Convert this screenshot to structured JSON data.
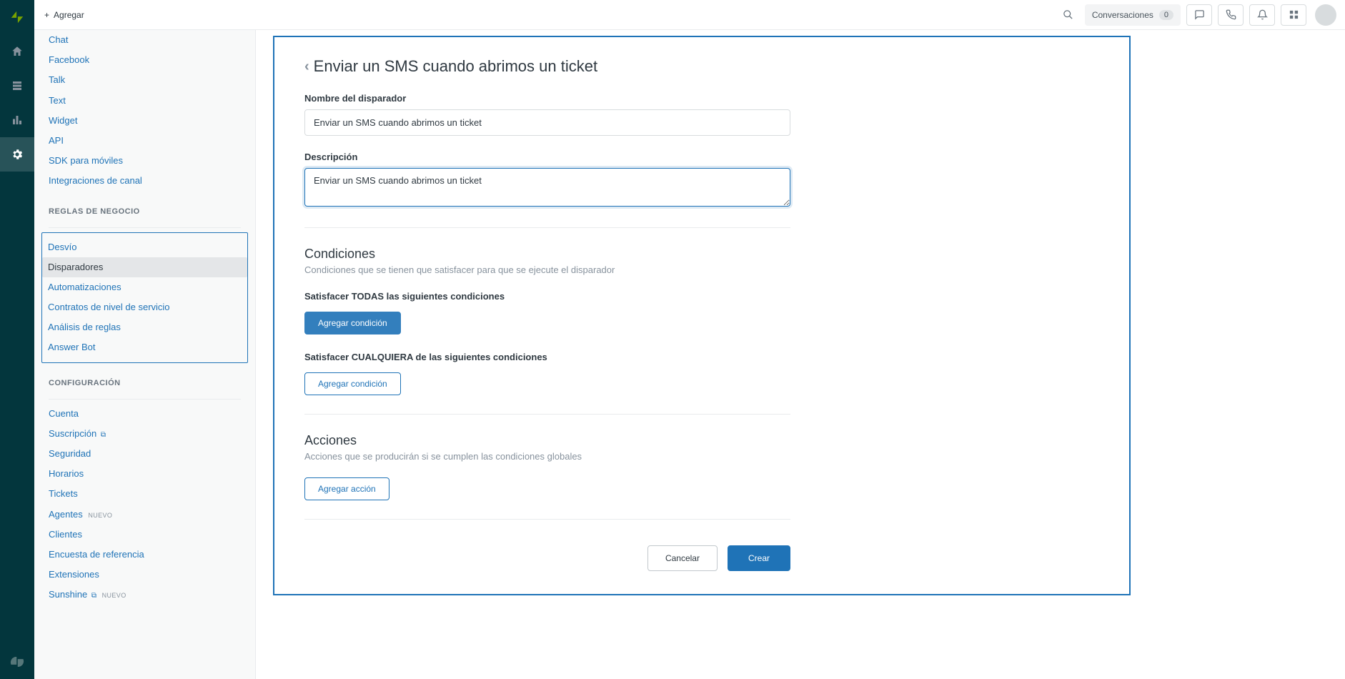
{
  "header": {
    "add_label": "Agregar",
    "conversations_label": "Conversaciones",
    "conversations_count": "0"
  },
  "sidebar": {
    "channels": [
      "Chat",
      "Facebook",
      "Talk",
      "Text",
      "Widget",
      "API",
      "SDK para móviles",
      "Integraciones de canal"
    ],
    "heading_rules": "REGLAS DE NEGOCIO",
    "rules": [
      "Desvío",
      "Disparadores",
      "Automatizaciones",
      "Contratos de nivel de servicio",
      "Análisis de reglas",
      "Answer Bot"
    ],
    "heading_config": "CONFIGURACIÓN",
    "config": [
      {
        "label": "Cuenta"
      },
      {
        "label": "Suscripción",
        "ext": true
      },
      {
        "label": "Seguridad"
      },
      {
        "label": "Horarios"
      },
      {
        "label": "Tickets"
      },
      {
        "label": "Agentes",
        "badge": "NUEVO"
      },
      {
        "label": "Clientes"
      },
      {
        "label": "Encuesta de referencia"
      },
      {
        "label": "Extensiones"
      },
      {
        "label": "Sunshine",
        "badge": "NUEVO",
        "ext": true
      }
    ]
  },
  "panel": {
    "title": "Enviar un SMS cuando abrimos un ticket",
    "name_label": "Nombre del disparador",
    "name_value": "Enviar un SMS cuando abrimos un ticket",
    "desc_label": "Descripción",
    "desc_value": "Enviar un SMS cuando abrimos un ticket",
    "conditions_title": "Condiciones",
    "conditions_desc": "Condiciones que se tienen que satisfacer para que se ejecute el disparador",
    "all_label": "Satisfacer TODAS las siguientes condiciones",
    "any_label": "Satisfacer CUALQUIERA de las siguientes condiciones",
    "add_condition_label": "Agregar condición",
    "actions_title": "Acciones",
    "actions_desc": "Acciones que se producirán si se cumplen las condiciones globales",
    "add_action_label": "Agregar acción",
    "cancel_label": "Cancelar",
    "create_label": "Crear"
  }
}
